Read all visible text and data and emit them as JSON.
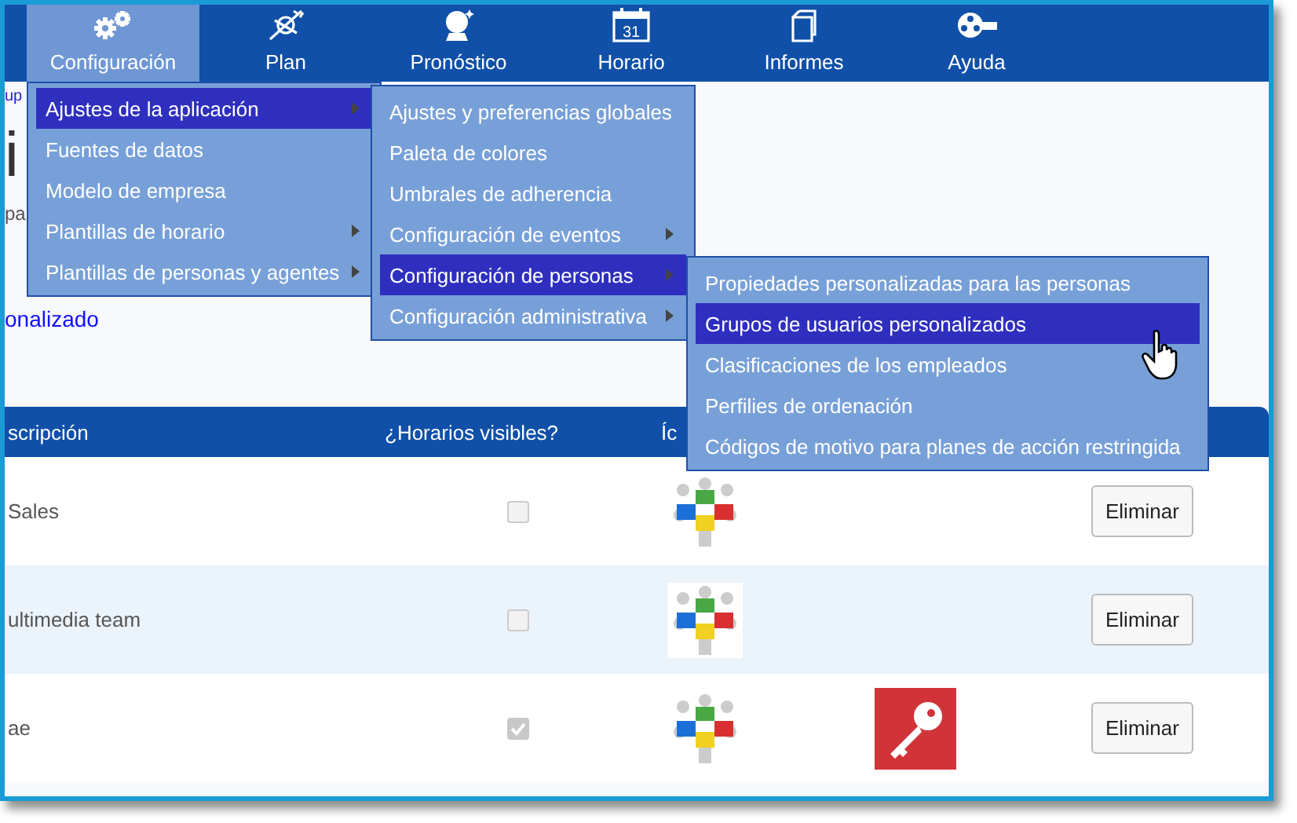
{
  "nav": [
    {
      "label": "Configuración",
      "selected": true
    },
    {
      "label": "Plan",
      "selected": false
    },
    {
      "label": "Pronóstico",
      "selected": false
    },
    {
      "label": "Horario",
      "calendar_day": "31",
      "selected": false
    },
    {
      "label": "Informes",
      "selected": false
    },
    {
      "label": "Ayuda",
      "selected": false
    }
  ],
  "breadcrumb": "up",
  "heading": "i",
  "subtitle": "pa",
  "add_link": "onalizado",
  "table": {
    "columns": [
      "scripción",
      "¿Horarios visibles?",
      "Íc"
    ],
    "rows": [
      {
        "description": "Sales",
        "visible": false,
        "secure": false,
        "button": "Eliminar"
      },
      {
        "description": "ultimedia team",
        "visible": false,
        "secure": false,
        "button": "Eliminar"
      },
      {
        "description": "ae",
        "visible": true,
        "secure": true,
        "button": "Eliminar"
      }
    ]
  },
  "menus": [
    {
      "items": [
        {
          "label": "Ajustes de la aplicación",
          "selected": true,
          "submenu": true
        },
        {
          "label": "Fuentes de datos",
          "selected": false,
          "submenu": false
        },
        {
          "label": "Modelo de empresa",
          "selected": false,
          "submenu": false
        },
        {
          "label": "Plantillas de horario",
          "selected": false,
          "submenu": true
        },
        {
          "label": "Plantillas de personas y agentes",
          "selected": false,
          "submenu": true
        }
      ]
    },
    {
      "items": [
        {
          "label": "Ajustes y preferencias globales",
          "selected": false,
          "submenu": false
        },
        {
          "label": "Paleta de colores",
          "selected": false,
          "submenu": false
        },
        {
          "label": "Umbrales de adherencia",
          "selected": false,
          "submenu": false
        },
        {
          "label": "Configuración de eventos",
          "selected": false,
          "submenu": true
        },
        {
          "label": "Configuración de personas",
          "selected": true,
          "submenu": true
        },
        {
          "label": "Configuración administrativa",
          "selected": false,
          "submenu": true
        }
      ]
    },
    {
      "items": [
        {
          "label": "Propiedades personalizadas para las personas",
          "selected": false,
          "submenu": false
        },
        {
          "label": "Grupos de usuarios personalizados",
          "selected": true,
          "submenu": false
        },
        {
          "label": "Clasificaciones de los empleados",
          "selected": false,
          "submenu": false
        },
        {
          "label": "Perfilies de ordenación",
          "selected": false,
          "submenu": false
        },
        {
          "label": "Códigos de motivo para planes de acción restringida",
          "selected": false,
          "submenu": false
        }
      ]
    }
  ]
}
